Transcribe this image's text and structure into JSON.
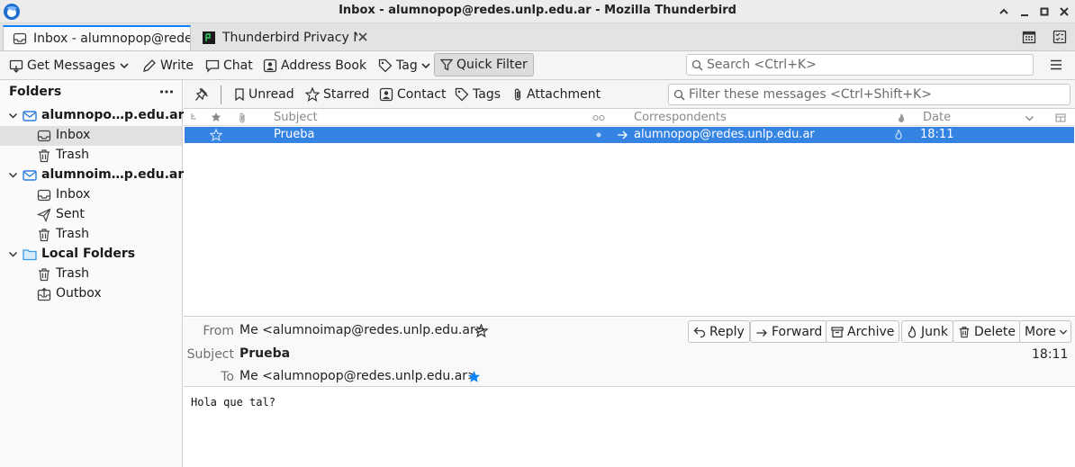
{
  "window": {
    "title": "Inbox - alumnopop@redes.unlp.edu.ar - Mozilla Thunderbird"
  },
  "tabs": [
    {
      "label": "Inbox - alumnopop@rede",
      "icon": "inbox-icon",
      "active": true
    },
    {
      "label": "Thunderbird Privacy N",
      "icon": "terminal-icon",
      "active": false
    }
  ],
  "toolbar": {
    "get_messages": "Get Messages",
    "write": "Write",
    "chat": "Chat",
    "address_book": "Address Book",
    "tag": "Tag",
    "quick_filter": "Quick Filter",
    "search_placeholder": "Search <Ctrl+K>"
  },
  "folders": {
    "header": "Folders",
    "items": [
      {
        "label": "alumnopo…p.edu.ar",
        "type": "account"
      },
      {
        "label": "Inbox",
        "type": "inbox",
        "selected": true
      },
      {
        "label": "Trash",
        "type": "trash"
      },
      {
        "label": "alumnoim…p.edu.ar",
        "type": "account"
      },
      {
        "label": "Inbox",
        "type": "inbox"
      },
      {
        "label": "Sent",
        "type": "sent"
      },
      {
        "label": "Trash",
        "type": "trash"
      },
      {
        "label": "Local Folders",
        "type": "local"
      },
      {
        "label": "Trash",
        "type": "trash"
      },
      {
        "label": "Outbox",
        "type": "outbox"
      }
    ]
  },
  "quick_filter": {
    "unread": "Unread",
    "starred": "Starred",
    "contact": "Contact",
    "tags": "Tags",
    "attachment": "Attachment",
    "filter_placeholder": "Filter these messages <Ctrl+Shift+K>"
  },
  "thread": {
    "columns": {
      "subject": "Subject",
      "correspondents": "Correspondents",
      "date": "Date"
    },
    "messages": [
      {
        "subject": "Prueba",
        "correspondent": "alumnopop@redes.unlp.edu.ar",
        "date": "18:11",
        "selected": true
      }
    ]
  },
  "message": {
    "from_label": "From",
    "from_value": "Me <alumnoimap@redes.unlp.edu.ar>",
    "subject_label": "Subject",
    "subject_value": "Prueba",
    "to_label": "To",
    "to_value": "Me <alumnopop@redes.unlp.edu.ar>",
    "time": "18:11",
    "buttons": {
      "reply": "Reply",
      "forward": "Forward",
      "archive": "Archive",
      "junk": "Junk",
      "delete": "Delete",
      "more": "More"
    },
    "body": "Hola que tal?"
  },
  "colors": {
    "selection": "#3584e4",
    "accent": "#0a84ff",
    "account_icon": "#2a7de1",
    "folder_icon": "#3a9ae6"
  }
}
